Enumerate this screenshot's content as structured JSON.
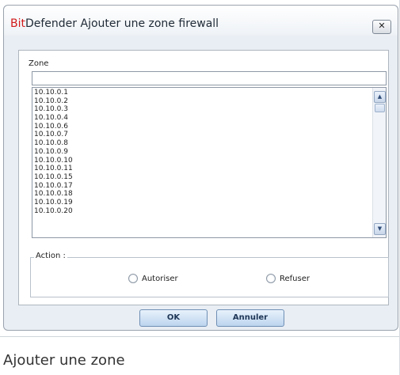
{
  "window": {
    "title_brand": "Bit",
    "title_rest": "Defender Ajouter une zone firewall",
    "close_glyph": "✕"
  },
  "zone": {
    "label": "Zone",
    "value": "",
    "items": [
      "10.10.0.1",
      "10.10.0.2",
      "10.10.0.3",
      "10.10.0.4",
      "10.10.0.6",
      "10.10.0.7",
      "10.10.0.8",
      "10.10.0.9",
      "10.10.0.10",
      "10.10.0.11",
      "10.10.0.15",
      "10.10.0.17",
      "10.10.0.18",
      "10.10.0.19",
      "10.10.0.20"
    ]
  },
  "action": {
    "legend": "Action :",
    "allow_label": "Autoriser",
    "deny_label": "Refuser"
  },
  "buttons": {
    "ok": "OK",
    "cancel": "Annuler"
  },
  "caption": "Ajouter une zone",
  "colors": {
    "brand": "#d11a1a",
    "button_border": "#6f8fb4"
  }
}
